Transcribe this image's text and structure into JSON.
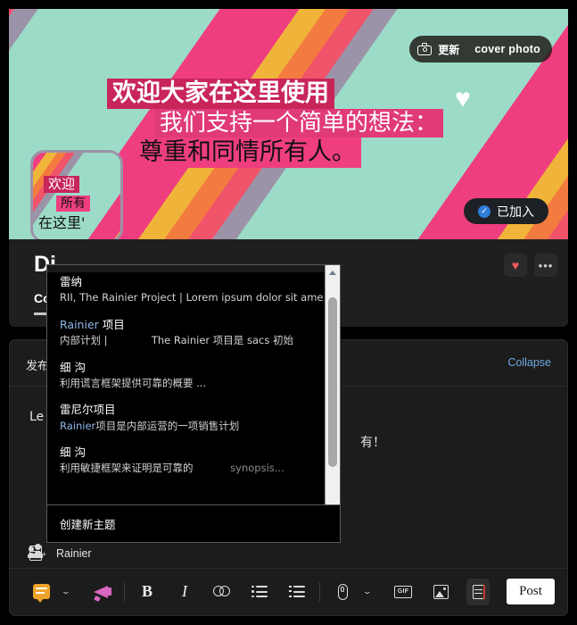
{
  "cover": {
    "update_button": {
      "icon": "camera-icon",
      "label_cn": "更新",
      "label_en": "cover photo"
    },
    "headline_line1": "欢迎大家在这里使用",
    "headline_line2": "我们支持一个简单的想法：",
    "headline_line3": "尊重和同情所有人。",
    "heart_glyph": "♥",
    "joined_button": {
      "check": "✓",
      "label": "已加入"
    },
    "colors": {
      "mint": "#9cdbc7",
      "pink": "#ef3e7f",
      "crimson": "#c8255a",
      "orange": "#f47b3f",
      "yellow": "#f0b43a",
      "red": "#f0546a",
      "mauve": "#9b93a8"
    }
  },
  "avatar": {
    "line1": "欢迎",
    "line2": "所有",
    "line3": "在这里'"
  },
  "header": {
    "group_title": "Di",
    "tabs": [
      {
        "label": "Con",
        "active": true
      }
    ],
    "actions": [
      {
        "name": "favorite-button",
        "glyph": "♥"
      },
      {
        "name": "more-options-button",
        "glyph": "•••"
      }
    ]
  },
  "composer": {
    "post_to_label": "发布",
    "collapse_label": "Collapse",
    "body_text_left": "Le",
    "body_text_right": "有！",
    "topic": {
      "icon": "book-icon",
      "name": "Rainier"
    },
    "toolbar": {
      "items": [
        {
          "name": "announcement-type-icon",
          "kind": "speech"
        },
        {
          "name": "announcement-dropdown-chevron",
          "kind": "chev"
        },
        {
          "name": "megaphone-icon",
          "kind": "megaphone"
        },
        {
          "name": "bold-button",
          "kind": "glyph",
          "glyph": "B"
        },
        {
          "name": "italic-button",
          "kind": "glyph",
          "glyph": "I"
        },
        {
          "name": "link-button",
          "kind": "link"
        },
        {
          "name": "bulleted-list-button",
          "kind": "ul"
        },
        {
          "name": "numbered-list-button",
          "kind": "ol"
        },
        {
          "name": "attachment-button",
          "kind": "clip"
        },
        {
          "name": "attachment-dropdown-chevron",
          "kind": "chev"
        },
        {
          "name": "gif-button",
          "kind": "gif",
          "glyph": "GIF"
        },
        {
          "name": "image-button",
          "kind": "image"
        },
        {
          "name": "topic-button",
          "kind": "book"
        }
      ],
      "post_label": "Post"
    }
  },
  "dropdown": {
    "items": [
      {
        "title": "雷纳",
        "subtitle": "RII, The Rainier Project | Lorem ipsum dolor sit amet, co...",
        "title_blue_prefix": "",
        "sub_blue_prefix": ""
      },
      {
        "title": "项目",
        "title_blue_prefix": "Rainier",
        "subtitle": "内部计划 |",
        "subtitle_extra": "The Rainier 项目是 sacs 初始"
      },
      {
        "title": "细 沟",
        "subtitle": "利用谎言框架提供可靠的概要 ..."
      },
      {
        "title": "雷尼尔项目",
        "subtitle": "项目是内部运营的一项销售计划",
        "sub_blue_prefix": "Rainier"
      },
      {
        "title": "细 沟",
        "subtitle": "利用敏捷框架来证明是可靠的",
        "subtitle_extra": "synopsis..."
      }
    ],
    "footer_label": "创建新主题",
    "scrollbar": {
      "up_arrow": "▲",
      "down_arrow": "▼"
    }
  }
}
